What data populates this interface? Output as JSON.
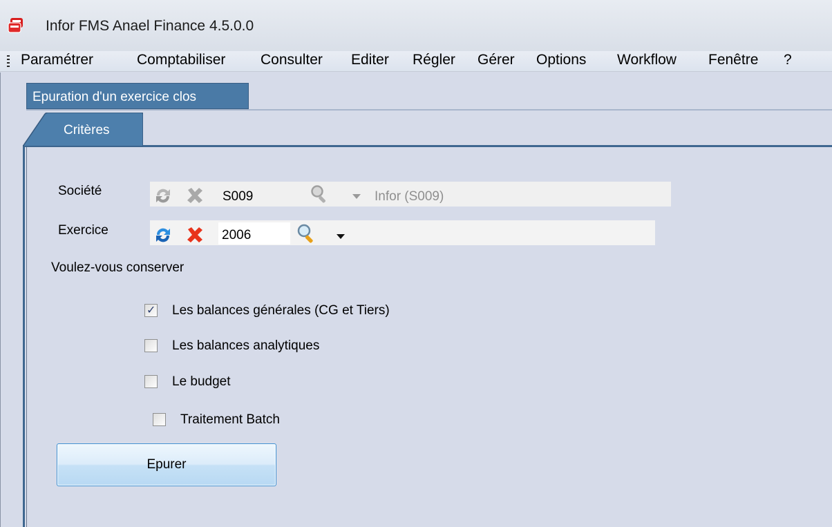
{
  "window": {
    "title": "Infor FMS Anael Finance 4.5.0.0"
  },
  "menu": [
    {
      "label": "Paramétrer"
    },
    {
      "label": "Comptabiliser"
    },
    {
      "label": "Consulter"
    },
    {
      "label": "Editer"
    },
    {
      "label": "Régler"
    },
    {
      "label": "Gérer"
    },
    {
      "label": "Options"
    },
    {
      "label": "Workflow"
    },
    {
      "label": "Fenêtre"
    },
    {
      "label": "?"
    }
  ],
  "document_tab": {
    "label": "Epuration d'un exercice clos"
  },
  "tabs": [
    {
      "label": "Critères",
      "selected": true
    }
  ],
  "form": {
    "societe": {
      "label": "Société",
      "value": "S009",
      "description": "Infor (S009)",
      "enabled": false
    },
    "exercice": {
      "label": "Exercice",
      "value": "2006",
      "enabled": true
    },
    "question": "Voulez-vous conserver",
    "options": [
      {
        "label": "Les balances générales (CG et Tiers)",
        "checked": true
      },
      {
        "label": "Les balances analytiques",
        "checked": false
      },
      {
        "label": "Le budget",
        "checked": false
      }
    ],
    "batch": {
      "label": "Traitement Batch",
      "checked": false
    },
    "submit_label": "Epurer"
  },
  "colors": {
    "tab_blue": "#4a7aa6",
    "background": "#d6dbe9",
    "clear_icon_active": "#e8331b"
  },
  "icons": [
    "app-logo-icon",
    "refresh-icon",
    "clear-icon",
    "search-icon",
    "dropdown-arrow-icon"
  ]
}
